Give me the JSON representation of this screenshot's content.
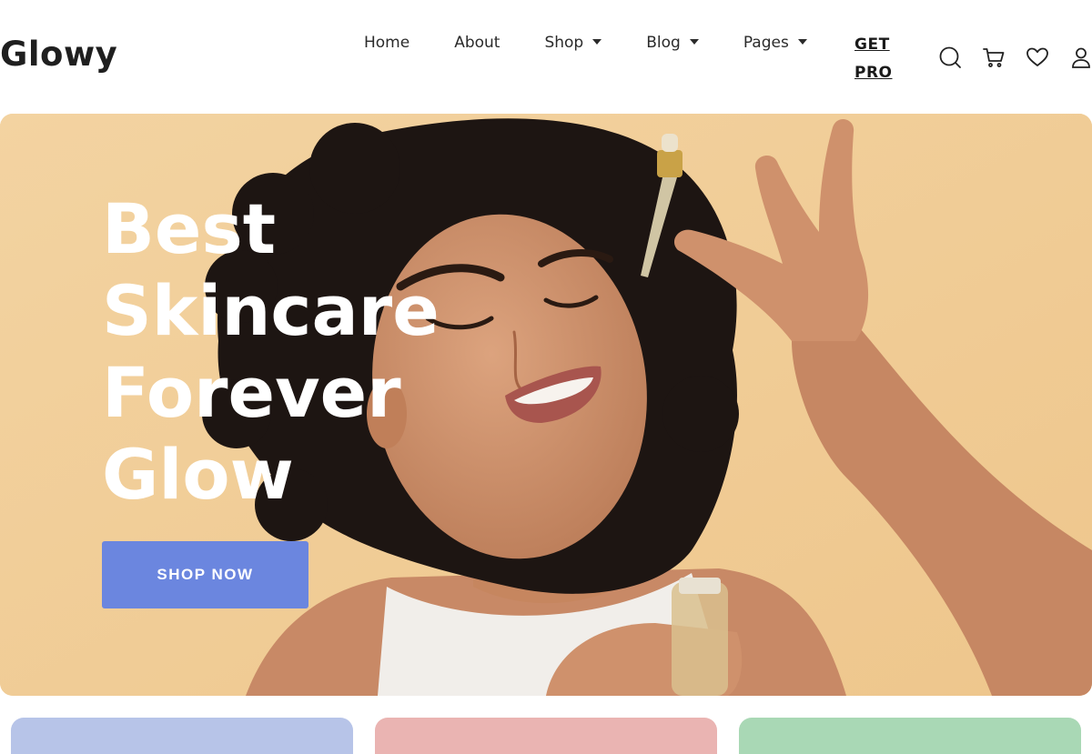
{
  "brand": {
    "name": "Glowy"
  },
  "nav": {
    "items": [
      {
        "label": "Home",
        "dropdown": false
      },
      {
        "label": "About",
        "dropdown": false
      },
      {
        "label": "Shop",
        "dropdown": true
      },
      {
        "label": "Blog",
        "dropdown": true
      },
      {
        "label": "Pages",
        "dropdown": true
      }
    ],
    "cta": "GET PRO",
    "icons": [
      "search-icon",
      "cart-icon",
      "heart-icon",
      "user-icon"
    ]
  },
  "hero": {
    "title_lines": [
      "Best",
      "Skincare",
      "Forever",
      "Glow"
    ],
    "button": "SHOP NOW",
    "background_color": "#f2cf98",
    "button_color": "#6b86df"
  },
  "categories": {
    "colors": [
      "#b7c4e8",
      "#eab4b2",
      "#a9d8b5"
    ]
  }
}
